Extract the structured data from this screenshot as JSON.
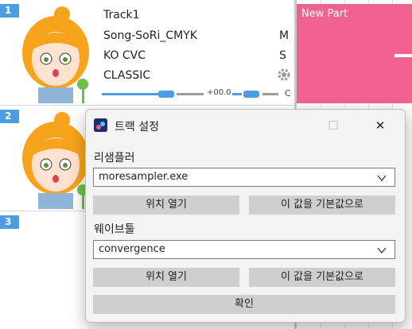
{
  "tracks": [
    {
      "number": "1",
      "name": "Track1",
      "singer": "Song-SoRi_CMYK",
      "phonemizer": "KO CVC",
      "renderer": "CLASSIC",
      "mute": "M",
      "solo": "S",
      "volume": "+00.0",
      "pan": "C"
    },
    {
      "number": "2"
    },
    {
      "number": "3"
    }
  ],
  "part": {
    "label": "New Part",
    "color": "#f06292"
  },
  "dialog": {
    "title": "트랙 설정",
    "resampler_label": "리샘플러",
    "resampler_value": "moresampler.exe",
    "open_location_1": "위치 열기",
    "set_default_1": "이 값을 기본값으로",
    "wavtool_label": "웨이브툴",
    "wavtool_value": "convergence",
    "open_location_2": "위치 열기",
    "set_default_2": "이 값을 기본값으로",
    "ok": "확인"
  },
  "colors": {
    "accent": "#4d9de0",
    "part": "#f06292"
  }
}
